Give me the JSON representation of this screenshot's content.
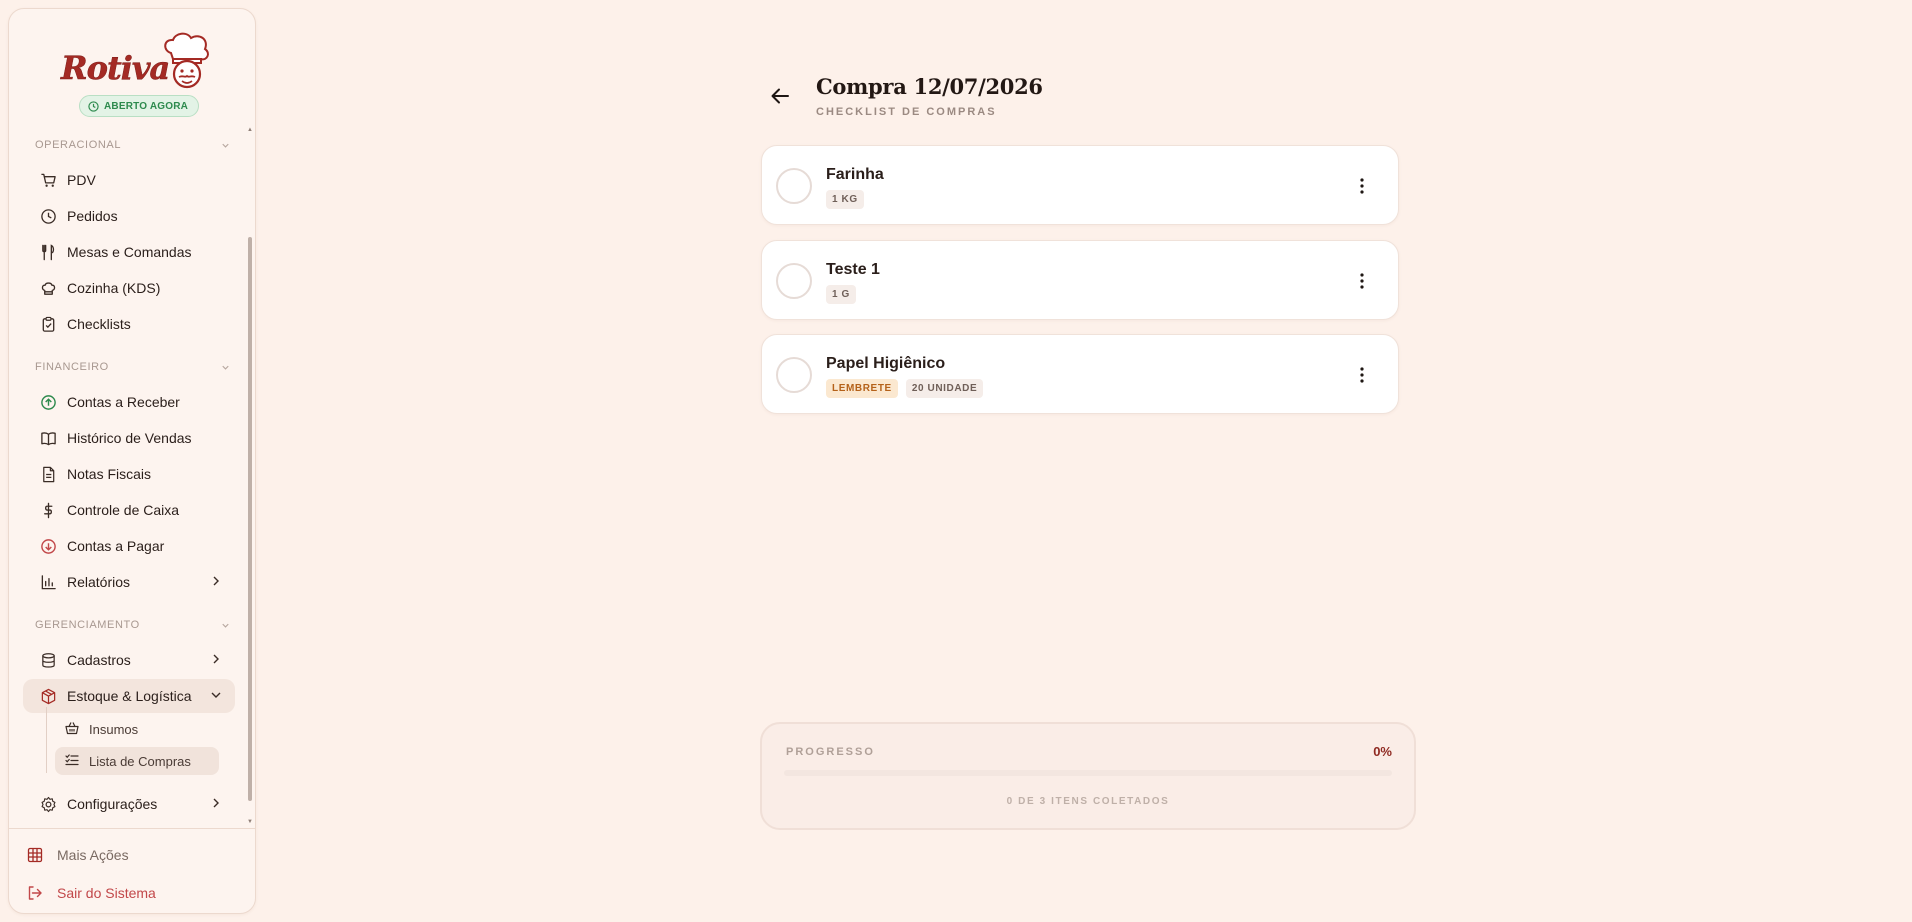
{
  "app": {
    "brand": "Rotiva",
    "status": "ABERTO AGORA"
  },
  "sidebar": {
    "sections": [
      {
        "label": "OPERACIONAL",
        "items": [
          {
            "label": "PDV",
            "icon": "cart-icon"
          },
          {
            "label": "Pedidos",
            "icon": "clock-icon"
          },
          {
            "label": "Mesas e Comandas",
            "icon": "utensils-icon"
          },
          {
            "label": "Cozinha (KDS)",
            "icon": "chef-hat-icon"
          },
          {
            "label": "Checklists",
            "icon": "clipboard-check-icon"
          }
        ]
      },
      {
        "label": "FINANCEIRO",
        "items": [
          {
            "label": "Contas a Receber",
            "icon": "arrow-up-circle-icon",
            "color": "#2d8a4d"
          },
          {
            "label": "Histórico de Vendas",
            "icon": "book-open-icon"
          },
          {
            "label": "Notas Fiscais",
            "icon": "file-text-icon"
          },
          {
            "label": "Controle de Caixa",
            "icon": "dollar-icon"
          },
          {
            "label": "Contas a Pagar",
            "icon": "arrow-down-circle-icon",
            "color": "#c2484a"
          },
          {
            "label": "Relatórios",
            "icon": "bar-chart-icon"
          }
        ]
      },
      {
        "label": "GERENCIAMENTO",
        "items": [
          {
            "label": "Cadastros",
            "icon": "database-icon"
          },
          {
            "label": "Estoque & Logística",
            "icon": "package-icon",
            "color": "#a42a24"
          },
          {
            "label": "Configurações",
            "icon": "gear-icon"
          }
        ],
        "subitems": [
          {
            "label": "Insumos",
            "icon": "basket-icon"
          },
          {
            "label": "Lista de Compras",
            "icon": "list-checks-icon"
          }
        ]
      }
    ],
    "footer": {
      "more": "Mais Ações",
      "logout": "Sair do Sistema"
    }
  },
  "main": {
    "title": "Compra 12/07/2026",
    "subtitle": "CHECKLIST DE COMPRAS",
    "items": [
      {
        "name": "Farinha",
        "tags": [
          "1 KG"
        ],
        "checked": false
      },
      {
        "name": "Teste 1",
        "tags": [
          "1 G"
        ],
        "checked": false
      },
      {
        "name": "Papel Higiênico",
        "tags": [
          "LEMBRETE",
          "20 UNIDADE"
        ],
        "checked": false
      }
    ],
    "progress": {
      "label": "PROGRESSO",
      "percent_text": "0%",
      "percent": 0,
      "summary": "0 DE 3 ITENS COLETADOS"
    }
  },
  "colors": {
    "accent": "#a42a24",
    "background": "#fdf1ea",
    "success": "#2d8a4d",
    "danger": "#c2484a",
    "reminder": "#b5621a"
  }
}
